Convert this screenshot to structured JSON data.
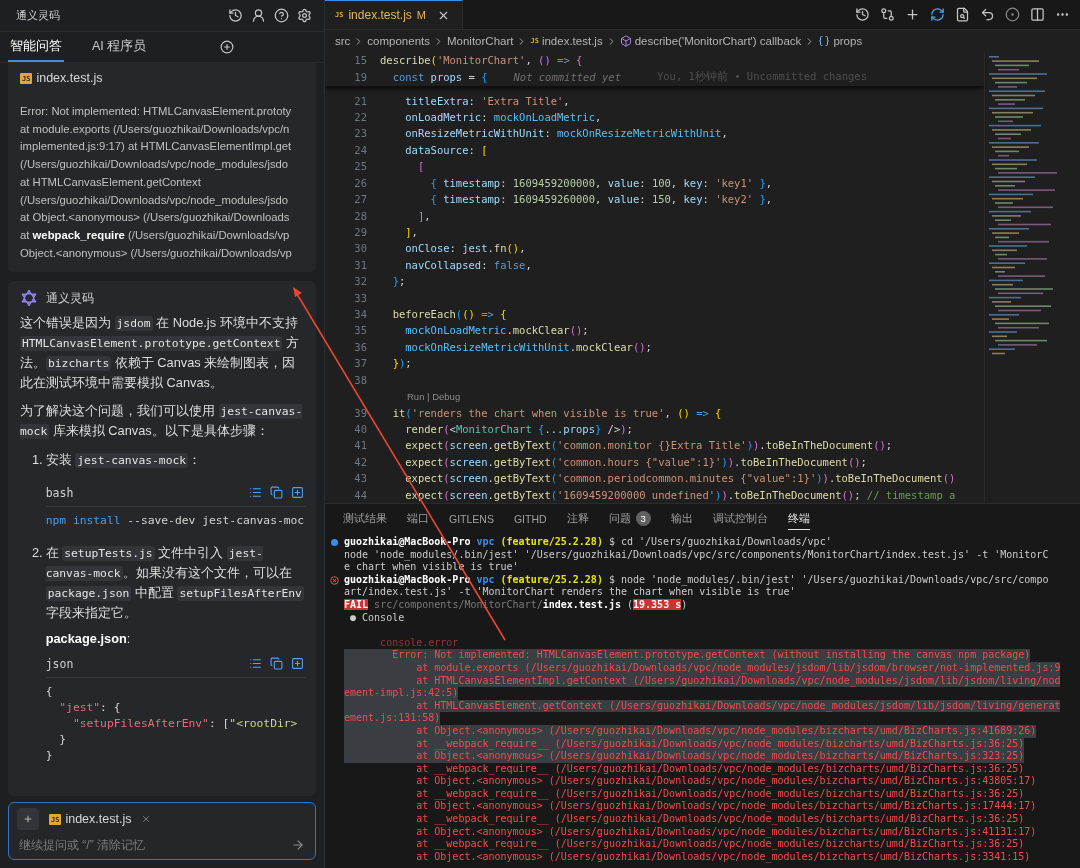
{
  "assistant_panel": {
    "title": "通义灵码",
    "tabs": [
      {
        "label": "智能问答",
        "selected": true
      },
      {
        "label": "AI 程序员",
        "selected": false
      }
    ],
    "context_card": {
      "file": {
        "badge": "JS",
        "name": "index.test.js"
      },
      "lines": [
        "Error: Not implemented: HTMLCanvasElement.prototy",
        "at module.exports (/Users/guozhikai/Downloads/vpc/n",
        "implemented.js:9:17) at HTMLCanvasElementImpl.get",
        "(/Users/guozhikai/Downloads/vpc/node_modules/jsdo",
        "at HTMLCanvasElement.getContext",
        "(/Users/guozhikai/Downloads/vpc/node_modules/jsdo",
        "at Object.<anonymous> (/Users/guozhikai/Downloads",
        "at **webpack_require** (/Users/guozhikai/Downloads/vp",
        "Object.<anonymous> (/Users/guozhikai/Downloads/vp"
      ]
    },
    "message": {
      "author": "通义灵码",
      "blocks": [
        {
          "kind": "paragraph",
          "segments": [
            {
              "text": "这个错误是因为 ",
              "kind": "text"
            },
            {
              "text": "jsdom",
              "kind": "code"
            },
            {
              "text": " 在 Node.js 环境中不支持 ",
              "kind": "text"
            },
            {
              "text": "HTMLCanvasElement.prototype.getContext",
              "kind": "code"
            },
            {
              "text": " 方法。",
              "kind": "text"
            },
            {
              "text": "bizcharts",
              "kind": "code"
            },
            {
              "text": " 依赖于 Canvas 来绘制图表，因此在测试环境中需要模拟 Canvas。",
              "kind": "text"
            }
          ]
        },
        {
          "kind": "paragraph",
          "segments": [
            {
              "text": "为了解决这个问题，我们可以使用 ",
              "kind": "text"
            },
            {
              "text": "jest-canvas-mock",
              "kind": "code"
            },
            {
              "text": " 库来模拟 Canvas。以下是具体步骤：",
              "kind": "text"
            }
          ]
        },
        {
          "kind": "list",
          "items": [
            {
              "number": "1.",
              "blocks": [
                {
                  "kind": "paragraph",
                  "segments": [
                    {
                      "text": "安装 ",
                      "kind": "text"
                    },
                    {
                      "text": "jest-canvas-mock",
                      "kind": "code"
                    },
                    {
                      "text": "：",
                      "kind": "text"
                    }
                  ]
                },
                {
                  "kind": "code",
                  "language": "bash",
                  "lines": [
                    [
                      {
                        "text": "npm",
                        "kind": "cmd"
                      },
                      {
                        "text": " install",
                        "kind": "cmd"
                      },
                      {
                        "text": " --save-dev jest-canvas-moc",
                        "kind": "p"
                      }
                    ]
                  ]
                }
              ]
            },
            {
              "number": "2.",
              "blocks": [
                {
                  "kind": "paragraph",
                  "segments": [
                    {
                      "text": "在 ",
                      "kind": "text"
                    },
                    {
                      "text": "setupTests.js",
                      "kind": "code"
                    },
                    {
                      "text": " 文件中引入 ",
                      "kind": "text"
                    },
                    {
                      "text": "jest-canvas-mock",
                      "kind": "code"
                    },
                    {
                      "text": "。如果没有这个文件，可以在 ",
                      "kind": "text"
                    },
                    {
                      "text": "package.json",
                      "kind": "code"
                    },
                    {
                      "text": " 中配置 ",
                      "kind": "text"
                    },
                    {
                      "text": "setupFilesAfterEnv",
                      "kind": "code"
                    },
                    {
                      "text": " 字段来指定它。",
                      "kind": "text"
                    }
                  ]
                },
                {
                  "kind": "label",
                  "text": "**package.json**:"
                },
                {
                  "kind": "code",
                  "language": "json",
                  "lines": [
                    [
                      {
                        "text": "{",
                        "kind": "p"
                      }
                    ],
                    [
                      {
                        "text": "  \"jest\"",
                        "kind": "key"
                      },
                      {
                        "text": ": {",
                        "kind": "p"
                      }
                    ],
                    [
                      {
                        "text": "    \"setupFilesAfterEnv\"",
                        "kind": "key"
                      },
                      {
                        "text": ": [",
                        "kind": "p"
                      },
                      {
                        "text": "\"<rootDir>",
                        "kind": "str"
                      }
                    ],
                    [
                      {
                        "text": "  }",
                        "kind": "p"
                      }
                    ],
                    [
                      {
                        "text": "}",
                        "kind": "p"
                      }
                    ]
                  ]
                }
              ]
            }
          ]
        }
      ]
    },
    "input": {
      "file": {
        "badge": "JS",
        "name": "index.test.js"
      },
      "placeholder": "继续提问或 “/” 清除记忆"
    }
  },
  "editor": {
    "tab": {
      "badge": "JS",
      "name": "index.test.js",
      "status": "M",
      "selected": true
    },
    "breadcrumb": [
      {
        "label": "src",
        "kind": "folder"
      },
      {
        "label": "components",
        "kind": "folder"
      },
      {
        "label": "MonitorChart",
        "kind": "folder"
      },
      {
        "label": "index.test.js",
        "kind": "file",
        "badge": "JS"
      },
      {
        "label": "describe('MonitorChart') callback",
        "kind": "function"
      },
      {
        "label": "props",
        "kind": "variable"
      }
    ],
    "sticky_lines": [
      {
        "number": "15",
        "tokens": [
          {
            "text": "describe",
            "kind": "fn"
          },
          {
            "text": "(",
            "kind": "b1"
          },
          {
            "text": "'MonitorChart'",
            "kind": "str"
          },
          {
            "text": ", ",
            "kind": "p"
          },
          {
            "text": "()",
            "kind": "b2"
          },
          {
            "text": " => ",
            "kind": "kw"
          },
          {
            "text": "{",
            "kind": "b2"
          }
        ]
      },
      {
        "number": "19",
        "tokens": [
          {
            "text": "  const",
            "kind": "kw"
          },
          {
            "text": " props",
            "kind": "var"
          },
          {
            "text": " = ",
            "kind": "p"
          },
          {
            "text": "{",
            "kind": "b3"
          }
        ],
        "blame": {
          "status": "Not committed yet",
          "detail": "You, 1秒钟前 • Uncommitted changes"
        }
      }
    ],
    "lines": [
      {
        "kind": "code",
        "number": "21",
        "tokens": [
          {
            "text": "    titleExtra",
            "kind": "var"
          },
          {
            "text": ": ",
            "kind": "p"
          },
          {
            "text": "'Extra Title'",
            "kind": "str"
          },
          {
            "text": ",",
            "kind": "p"
          }
        ]
      },
      {
        "kind": "code",
        "number": "22",
        "tokens": [
          {
            "text": "    onLoadMetric",
            "kind": "var"
          },
          {
            "text": ": ",
            "kind": "p"
          },
          {
            "text": "mockOnLoadMetric",
            "kind": "teal"
          },
          {
            "text": ",",
            "kind": "p"
          }
        ]
      },
      {
        "kind": "code",
        "number": "23",
        "tokens": [
          {
            "text": "    onResizeMetricWithUnit",
            "kind": "var"
          },
          {
            "text": ": ",
            "kind": "p"
          },
          {
            "text": "mockOnResizeMetricWithUnit",
            "kind": "teal"
          },
          {
            "text": ",",
            "kind": "p"
          }
        ]
      },
      {
        "kind": "code",
        "number": "24",
        "tokens": [
          {
            "text": "    dataSource",
            "kind": "var"
          },
          {
            "text": ": ",
            "kind": "p"
          },
          {
            "text": "[",
            "kind": "b1"
          }
        ]
      },
      {
        "kind": "code",
        "number": "25",
        "tokens": [
          {
            "text": "      [",
            "kind": "b2"
          }
        ]
      },
      {
        "kind": "code",
        "number": "26",
        "tokens": [
          {
            "text": "        {",
            "kind": "b3"
          },
          {
            "text": " timestamp",
            "kind": "var"
          },
          {
            "text": ": ",
            "kind": "p"
          },
          {
            "text": "1609459200000",
            "kind": "num"
          },
          {
            "text": ", ",
            "kind": "p"
          },
          {
            "text": "value",
            "kind": "var"
          },
          {
            "text": ": ",
            "kind": "p"
          },
          {
            "text": "100",
            "kind": "num"
          },
          {
            "text": ", ",
            "kind": "p"
          },
          {
            "text": "key",
            "kind": "var"
          },
          {
            "text": ": ",
            "kind": "p"
          },
          {
            "text": "'key1'",
            "kind": "str"
          },
          {
            "text": " }",
            "kind": "b3"
          },
          {
            "text": ",",
            "kind": "p"
          }
        ]
      },
      {
        "kind": "code",
        "number": "27",
        "tokens": [
          {
            "text": "        {",
            "kind": "b3"
          },
          {
            "text": " timestamp",
            "kind": "var"
          },
          {
            "text": ": ",
            "kind": "p"
          },
          {
            "text": "1609459260000",
            "kind": "num"
          },
          {
            "text": ", ",
            "kind": "p"
          },
          {
            "text": "value",
            "kind": "var"
          },
          {
            "text": ": ",
            "kind": "p"
          },
          {
            "text": "150",
            "kind": "num"
          },
          {
            "text": ", ",
            "kind": "p"
          },
          {
            "text": "key",
            "kind": "var"
          },
          {
            "text": ": ",
            "kind": "p"
          },
          {
            "text": "'key2'",
            "kind": "str"
          },
          {
            "text": " }",
            "kind": "b3"
          },
          {
            "text": ",",
            "kind": "p"
          }
        ]
      },
      {
        "kind": "code",
        "number": "28",
        "tokens": [
          {
            "text": "      ]",
            "kind": "b2"
          },
          {
            "text": ",",
            "kind": "p"
          }
        ]
      },
      {
        "kind": "code",
        "number": "29",
        "tokens": [
          {
            "text": "    ]",
            "kind": "b1"
          },
          {
            "text": ",",
            "kind": "p"
          }
        ]
      },
      {
        "kind": "code",
        "number": "30",
        "tokens": [
          {
            "text": "    onClose",
            "kind": "var"
          },
          {
            "text": ": ",
            "kind": "p"
          },
          {
            "text": "jest",
            "kind": "var"
          },
          {
            "text": ".",
            "kind": "p"
          },
          {
            "text": "fn",
            "kind": "fn"
          },
          {
            "text": "()",
            "kind": "b1"
          },
          {
            "text": ",",
            "kind": "p"
          }
        ]
      },
      {
        "kind": "code",
        "number": "31",
        "tokens": [
          {
            "text": "    navCollapsed",
            "kind": "var"
          },
          {
            "text": ": ",
            "kind": "p"
          },
          {
            "text": "false",
            "kind": "kw"
          },
          {
            "text": ",",
            "kind": "p"
          }
        ]
      },
      {
        "kind": "code",
        "number": "32",
        "tokens": [
          {
            "text": "  }",
            "kind": "b3"
          },
          {
            "text": ";",
            "kind": "p"
          }
        ]
      },
      {
        "kind": "code",
        "number": "33"
      },
      {
        "kind": "code",
        "number": "34",
        "tokens": [
          {
            "text": "  beforeEach",
            "kind": "fn"
          },
          {
            "text": "(",
            "kind": "b3"
          },
          {
            "text": "()",
            "kind": "b1"
          },
          {
            "text": " => ",
            "kind": "kw"
          },
          {
            "text": "{",
            "kind": "b1"
          }
        ]
      },
      {
        "kind": "code",
        "number": "35",
        "tokens": [
          {
            "text": "    mockOnLoadMetric",
            "kind": "teal"
          },
          {
            "text": ".",
            "kind": "p"
          },
          {
            "text": "mockClear",
            "kind": "fn"
          },
          {
            "text": "()",
            "kind": "b2"
          },
          {
            "text": ";",
            "kind": "p"
          }
        ]
      },
      {
        "kind": "code",
        "number": "36",
        "tokens": [
          {
            "text": "    mockOnResizeMetricWithUnit",
            "kind": "teal"
          },
          {
            "text": ".",
            "kind": "p"
          },
          {
            "text": "mockClear",
            "kind": "fn"
          },
          {
            "text": "()",
            "kind": "b2"
          },
          {
            "text": ";",
            "kind": "p"
          }
        ]
      },
      {
        "kind": "code",
        "number": "37",
        "tokens": [
          {
            "text": "  }",
            "kind": "b1"
          },
          {
            "text": ")",
            "kind": "b3"
          },
          {
            "text": ";",
            "kind": "p"
          }
        ]
      },
      {
        "kind": "code",
        "number": "38"
      },
      {
        "kind": "codelens",
        "text": "Run | Debug"
      },
      {
        "kind": "code",
        "number": "39",
        "tokens": [
          {
            "text": "  it",
            "kind": "fn"
          },
          {
            "text": "(",
            "kind": "b3"
          },
          {
            "text": "'renders the chart when visible is true'",
            "kind": "str"
          },
          {
            "text": ", ",
            "kind": "p"
          },
          {
            "text": "()",
            "kind": "b1"
          },
          {
            "text": " => ",
            "kind": "kw"
          },
          {
            "text": "{",
            "kind": "b1"
          }
        ]
      },
      {
        "kind": "code",
        "number": "40",
        "tokens": [
          {
            "text": "    render",
            "kind": "fn"
          },
          {
            "text": "(",
            "kind": "b2"
          },
          {
            "text": "<",
            "kind": "p"
          },
          {
            "text": "MonitorChart",
            "kind": "tag"
          },
          {
            "text": " {",
            "kind": "b3"
          },
          {
            "text": "...props",
            "kind": "var"
          },
          {
            "text": "}",
            "kind": "b3"
          },
          {
            "text": " />",
            "kind": "p"
          },
          {
            "text": ")",
            "kind": "b2"
          },
          {
            "text": ";",
            "kind": "p"
          }
        ]
      },
      {
        "kind": "code",
        "number": "41",
        "tokens": [
          {
            "text": "    expect",
            "kind": "fn"
          },
          {
            "text": "(",
            "kind": "b2"
          },
          {
            "text": "screen",
            "kind": "var"
          },
          {
            "text": ".",
            "kind": "p"
          },
          {
            "text": "getByText",
            "kind": "fn"
          },
          {
            "text": "(",
            "kind": "b3"
          },
          {
            "text": "'common.monitor {}Extra Title'",
            "kind": "str"
          },
          {
            "text": ")",
            "kind": "b3"
          },
          {
            "text": ")",
            "kind": "b2"
          },
          {
            "text": ".",
            "kind": "p"
          },
          {
            "text": "toBeInTheDocument",
            "kind": "fn"
          },
          {
            "text": "()",
            "kind": "b2"
          },
          {
            "text": ";",
            "kind": "p"
          }
        ]
      },
      {
        "kind": "code",
        "number": "42",
        "tokens": [
          {
            "text": "    expect",
            "kind": "fn"
          },
          {
            "text": "(",
            "kind": "b2"
          },
          {
            "text": "screen",
            "kind": "var"
          },
          {
            "text": ".",
            "kind": "p"
          },
          {
            "text": "getByText",
            "kind": "fn"
          },
          {
            "text": "(",
            "kind": "b3"
          },
          {
            "text": "'common.hours {\"value\":1}'",
            "kind": "str"
          },
          {
            "text": ")",
            "kind": "b3"
          },
          {
            "text": ")",
            "kind": "b2"
          },
          {
            "text": ".",
            "kind": "p"
          },
          {
            "text": "toBeInTheDocument",
            "kind": "fn"
          },
          {
            "text": "()",
            "kind": "b2"
          },
          {
            "text": ";",
            "kind": "p"
          }
        ]
      },
      {
        "kind": "code",
        "number": "43",
        "tokens": [
          {
            "text": "    expect",
            "kind": "fn"
          },
          {
            "text": "(",
            "kind": "b2"
          },
          {
            "text": "screen",
            "kind": "var"
          },
          {
            "text": ".",
            "kind": "p"
          },
          {
            "text": "getByText",
            "kind": "fn"
          },
          {
            "text": "(",
            "kind": "b3"
          },
          {
            "text": "'common.periodcommon.minutes {\"value\":1}'",
            "kind": "str"
          },
          {
            "text": ")",
            "kind": "b3"
          },
          {
            "text": ")",
            "kind": "b2"
          },
          {
            "text": ".",
            "kind": "p"
          },
          {
            "text": "toBeInTheDocument",
            "kind": "fn"
          },
          {
            "text": "()",
            "kind": "b2"
          }
        ]
      },
      {
        "kind": "code",
        "number": "44",
        "tokens": [
          {
            "text": "    expect",
            "kind": "fn"
          },
          {
            "text": "(",
            "kind": "b2"
          },
          {
            "text": "screen",
            "kind": "var"
          },
          {
            "text": ".",
            "kind": "p"
          },
          {
            "text": "getByText",
            "kind": "fn"
          },
          {
            "text": "(",
            "kind": "b3"
          },
          {
            "text": "'1609459200000 undefined'",
            "kind": "str"
          },
          {
            "text": ")",
            "kind": "b3"
          },
          {
            "text": ")",
            "kind": "b2"
          },
          {
            "text": ".",
            "kind": "p"
          },
          {
            "text": "toBeInTheDocument",
            "kind": "fn"
          },
          {
            "text": "()",
            "kind": "b2"
          },
          {
            "text": ";",
            "kind": "p"
          },
          {
            "text": " // timestamp a",
            "kind": "cm"
          }
        ]
      }
    ]
  },
  "panel": {
    "tabs": [
      {
        "label": "测试结果",
        "selected": false
      },
      {
        "label": "端口",
        "selected": false
      },
      {
        "label": "GITLENS",
        "selected": false
      },
      {
        "label": "GITHD",
        "selected": false
      },
      {
        "label": "注释",
        "selected": false
      },
      {
        "label": "问题",
        "selected": false,
        "badge": "3"
      },
      {
        "label": "输出",
        "selected": false
      },
      {
        "label": "调试控制台",
        "selected": false
      },
      {
        "label": "终端",
        "selected": true
      }
    ],
    "terminal": [
      {
        "kind": "prompt",
        "failed": false,
        "segments": [
          {
            "text": "guozhikai@MacBook-Pro",
            "kind": "user"
          },
          {
            "text": " vpc",
            "kind": "dir"
          },
          {
            "text": " (feature/25.2.28)",
            "kind": "branch"
          },
          {
            "text": " $ cd '/Users/guozhikai/Downloads/vpc'",
            "kind": "p"
          }
        ]
      },
      {
        "kind": "text",
        "segments": [
          {
            "text": "node 'node_modules/.bin/jest' '/Users/guozhikai/Downloads/vpc/src/components/MonitorChart/index.test.js' -t 'MonitorC",
            "kind": "p"
          }
        ]
      },
      {
        "kind": "text",
        "segments": [
          {
            "text": "e chart when visible is true'",
            "kind": "p"
          }
        ]
      },
      {
        "kind": "prompt",
        "failed": true,
        "segments": [
          {
            "text": "guozhikai@MacBook-Pro",
            "kind": "user"
          },
          {
            "text": " vpc",
            "kind": "dir"
          },
          {
            "text": " (feature/25.2.28)",
            "kind": "branch"
          },
          {
            "text": " $ node 'node_modules/.bin/jest' '/Users/guozhikai/Downloads/vpc/src/compo",
            "kind": "p"
          }
        ]
      },
      {
        "kind": "text",
        "segments": [
          {
            "text": "art/index.test.js' -t 'MonitorChart renders the chart when visible is true'",
            "kind": "p"
          }
        ]
      },
      {
        "kind": "text",
        "segments": [
          {
            "text": "FAIL",
            "kind": "badge"
          },
          {
            "text": " src/components/MonitorChart/",
            "kind": "dim"
          },
          {
            "text": "index.test.js",
            "kind": "bold"
          },
          {
            "text": " (",
            "kind": "p"
          },
          {
            "text": "19.353 s",
            "kind": "badge"
          },
          {
            "text": ")",
            "kind": "p"
          }
        ]
      },
      {
        "kind": "text",
        "segments": [
          {
            "text": " ● Console",
            "kind": "p"
          }
        ]
      },
      {
        "kind": "blank"
      },
      {
        "kind": "text",
        "segments": [
          {
            "text": "      console.error",
            "kind": "errdim"
          }
        ]
      },
      {
        "kind": "error",
        "selected": true,
        "text": "        Error: Not implemented: HTMLCanvasElement.prototype.getContext (without installing the canvas npm package)"
      },
      {
        "kind": "error",
        "selected": true,
        "text": "            at module.exports (/Users/guozhikai/Downloads/vpc/node_modules/jsdom/lib/jsdom/browser/not-implemented.js:9"
      },
      {
        "kind": "error",
        "selected": true,
        "text": "            at HTMLCanvasElementImpl.getContext (/Users/guozhikai/Downloads/vpc/node_modules/jsdom/lib/jsdom/living/nod"
      },
      {
        "kind": "error",
        "selected": true,
        "text": "ement-impl.js:42:5)"
      },
      {
        "kind": "error",
        "selected": true,
        "text": "            at HTMLCanvasElement.getContext (/Users/guozhikai/Downloads/vpc/node_modules/jsdom/lib/jsdom/living/generat"
      },
      {
        "kind": "error",
        "selected": true,
        "text": "ement.js:131:58)"
      },
      {
        "kind": "error",
        "selected": true,
        "text": "            at Object.<anonymous> (/Users/guozhikai/Downloads/vpc/node_modules/bizcharts/umd/BizCharts.js:41689:26)"
      },
      {
        "kind": "error",
        "selected": true,
        "text": "            at __webpack_require__ (/Users/guozhikai/Downloads/vpc/node_modules/bizcharts/umd/BizCharts.js:36:25)"
      },
      {
        "kind": "error",
        "selected": true,
        "text": "            at Object.<anonymous> (/Users/guozhikai/Downloads/vpc/node_modules/bizcharts/umd/BizCharts.js:323:25)"
      },
      {
        "kind": "error",
        "selected": false,
        "text": "            at __webpack_require__ (/Users/guozhikai/Downloads/vpc/node_modules/bizcharts/umd/BizCharts.js:36:25)"
      },
      {
        "kind": "error",
        "selected": false,
        "text": "            at Object.<anonymous> (/Users/guozhikai/Downloads/vpc/node_modules/bizcharts/umd/BizCharts.js:43805:17)"
      },
      {
        "kind": "error",
        "selected": false,
        "text": "            at __webpack_require__ (/Users/guozhikai/Downloads/vpc/node_modules/bizcharts/umd/BizCharts.js:36:25)"
      },
      {
        "kind": "error",
        "selected": false,
        "text": "            at Object.<anonymous> (/Users/guozhikai/Downloads/vpc/node_modules/bizcharts/umd/BizCharts.js:17444:17)"
      },
      {
        "kind": "error",
        "selected": false,
        "text": "            at __webpack_require__ (/Users/guozhikai/Downloads/vpc/node_modules/bizcharts/umd/BizCharts.js:36:25)"
      },
      {
        "kind": "error",
        "selected": false,
        "text": "            at Object.<anonymous> (/Users/guozhikai/Downloads/vpc/node_modules/bizcharts/umd/BizCharts.js:41131:17)"
      },
      {
        "kind": "error",
        "selected": false,
        "text": "            at __webpack_require__ (/Users/guozhikai/Downloads/vpc/node_modules/bizcharts/umd/BizCharts.js:36:25)"
      },
      {
        "kind": "error",
        "selected": false,
        "text": "            at Object.<anonymous> (/Users/guozhikai/Downloads/vpc/node_modules/bizcharts/umd/BizCharts.js:3341:15)"
      }
    ]
  }
}
